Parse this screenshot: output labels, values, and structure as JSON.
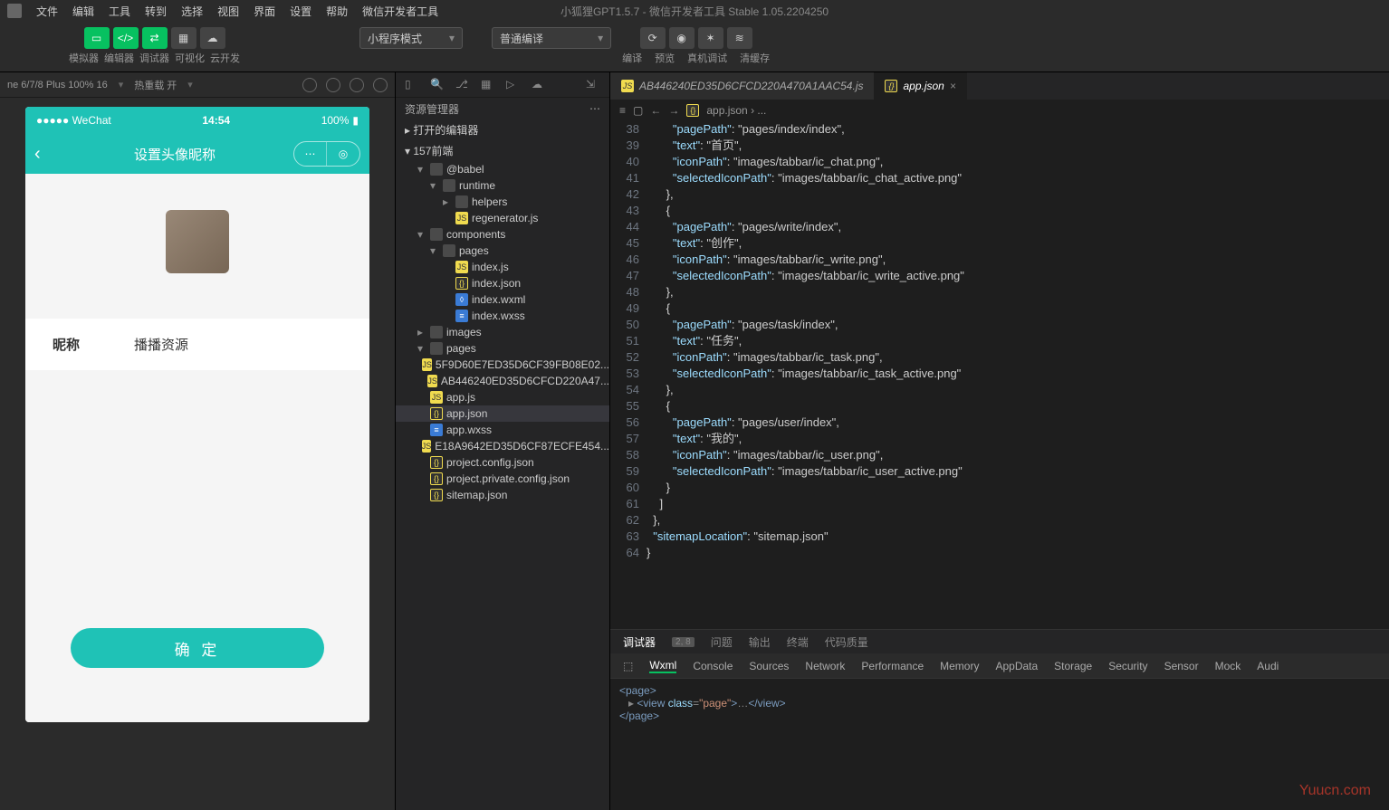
{
  "titlebar": "小狐狸GPT1.5.7 - 微信开发者工具 Stable 1.05.2204250",
  "menu": [
    "文件",
    "编辑",
    "工具",
    "转到",
    "选择",
    "视图",
    "界面",
    "设置",
    "帮助",
    "微信开发者工具"
  ],
  "toolbar": {
    "group1_labels": [
      "模拟器",
      "编辑器",
      "调试器",
      "可视化",
      "云开发"
    ],
    "mode_select": "小程序模式",
    "compile_select": "普通编译",
    "action_labels": [
      "编译",
      "预览",
      "真机调试",
      "清缓存"
    ]
  },
  "sim": {
    "device": "ne 6/7/8 Plus 100% 16",
    "hotreload": "热重载 开",
    "status_left": "●●●●● WeChat",
    "status_time": "14:54",
    "status_right": "100%",
    "nav_title": "设置头像昵称",
    "nick_label": "昵称",
    "nick_value": "播播资源",
    "confirm": "确 定"
  },
  "explorer": {
    "title": "资源管理器",
    "open_editors": "打开的编辑器",
    "root": "157前端",
    "tree": [
      {
        "d": 1,
        "t": "folder-open",
        "n": "@babel"
      },
      {
        "d": 2,
        "t": "folder-open",
        "n": "runtime"
      },
      {
        "d": 3,
        "t": "folder",
        "n": "helpers"
      },
      {
        "d": 3,
        "t": "js",
        "n": "regenerator.js"
      },
      {
        "d": 1,
        "t": "folder-open",
        "n": "components"
      },
      {
        "d": 2,
        "t": "folder-open",
        "n": "pages"
      },
      {
        "d": 3,
        "t": "js",
        "n": "index.js"
      },
      {
        "d": 3,
        "t": "json",
        "n": "index.json"
      },
      {
        "d": 3,
        "t": "wxml",
        "n": "index.wxml"
      },
      {
        "d": 3,
        "t": "wxss",
        "n": "index.wxss"
      },
      {
        "d": 1,
        "t": "folder",
        "n": "images"
      },
      {
        "d": 1,
        "t": "folder-open",
        "n": "pages"
      },
      {
        "d": 1,
        "t": "js",
        "n": "5F9D60E7ED35D6CF39FB08E02..."
      },
      {
        "d": 1,
        "t": "js",
        "n": "AB446240ED35D6CFCD220A47..."
      },
      {
        "d": 1,
        "t": "js",
        "n": "app.js"
      },
      {
        "d": 1,
        "t": "json",
        "n": "app.json",
        "sel": true
      },
      {
        "d": 1,
        "t": "wxss",
        "n": "app.wxss"
      },
      {
        "d": 1,
        "t": "js",
        "n": "E18A9642ED35D6CF87ECFE454..."
      },
      {
        "d": 1,
        "t": "json",
        "n": "project.config.json"
      },
      {
        "d": 1,
        "t": "json",
        "n": "project.private.config.json"
      },
      {
        "d": 1,
        "t": "json",
        "n": "sitemap.json"
      }
    ]
  },
  "editor": {
    "tab1": "AB446240ED35D6CFCD220A470A1AAC54.js",
    "tab2": "app.json",
    "breadcrumb": "app.json › ...",
    "lines_start": 38,
    "lines_end": 64,
    "code": [
      "        \"pagePath\": \"pages/index/index\",",
      "        \"text\": \"首页\",",
      "        \"iconPath\": \"images/tabbar/ic_chat.png\",",
      "        \"selectedIconPath\": \"images/tabbar/ic_chat_active.png\"",
      "      },",
      "      {",
      "        \"pagePath\": \"pages/write/index\",",
      "        \"text\": \"创作\",",
      "        \"iconPath\": \"images/tabbar/ic_write.png\",",
      "        \"selectedIconPath\": \"images/tabbar/ic_write_active.png\"",
      "      },",
      "      {",
      "        \"pagePath\": \"pages/task/index\",",
      "        \"text\": \"任务\",",
      "        \"iconPath\": \"images/tabbar/ic_task.png\",",
      "        \"selectedIconPath\": \"images/tabbar/ic_task_active.png\"",
      "      },",
      "      {",
      "        \"pagePath\": \"pages/user/index\",",
      "        \"text\": \"我的\",",
      "        \"iconPath\": \"images/tabbar/ic_user.png\",",
      "        \"selectedIconPath\": \"images/tabbar/ic_user_active.png\"",
      "      }",
      "    ]",
      "  },",
      "  \"sitemapLocation\": \"sitemap.json\"",
      "}"
    ]
  },
  "bottom": {
    "row1": [
      "调试器",
      "2, 8",
      "问题",
      "输出",
      "终端",
      "代码质量"
    ],
    "row2": [
      "Wxml",
      "Console",
      "Sources",
      "Network",
      "Performance",
      "Memory",
      "AppData",
      "Storage",
      "Security",
      "Sensor",
      "Mock",
      "Audi"
    ],
    "wxml1": "<page>",
    "wxml2": "▸ <view class=\"page\">…</view>",
    "wxml3": "</page>"
  },
  "watermark": "Yuucn.com"
}
